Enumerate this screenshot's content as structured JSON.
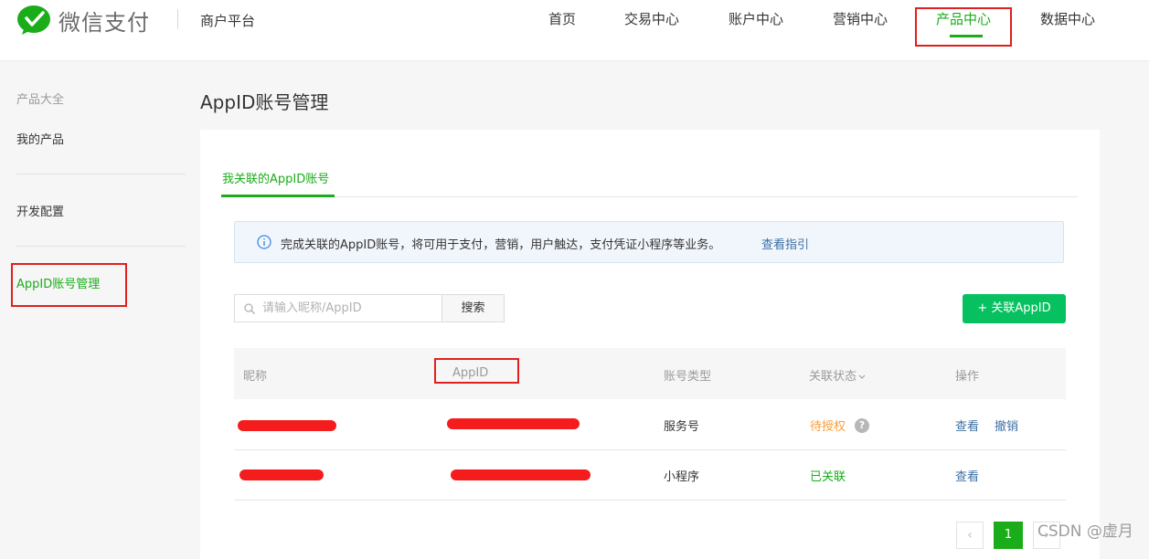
{
  "header": {
    "logo_text": "微信支付",
    "platform": "商户平台",
    "nav": [
      "首页",
      "交易中心",
      "账户中心",
      "营销中心",
      "产品中心",
      "数据中心"
    ],
    "active_nav": "产品中心"
  },
  "sidebar": {
    "group_title": "产品大全",
    "items": [
      "我的产品",
      "开发配置",
      "AppID账号管理"
    ],
    "active_item": "AppID账号管理"
  },
  "page": {
    "title": "AppID账号管理",
    "tab": "我关联的AppID账号",
    "notice": {
      "icon": "info-icon",
      "text": "完成关联的AppID账号，将可用于支付，营销，用户触达，支付凭证小程序等业务。",
      "link": "查看指引"
    },
    "search": {
      "placeholder": "请输入昵称/AppID",
      "value": "",
      "button": "搜索"
    },
    "add_button": "+ 关联AppID"
  },
  "table": {
    "headers": [
      "昵称",
      "AppID",
      "账号类型",
      "关联状态",
      "操作"
    ],
    "status_sort_icon": "chevron-down-icon",
    "rows": [
      {
        "nickname": "[redacted]",
        "appid": "[redacted]",
        "type": "服务号",
        "status": "待授权",
        "help_icon": "?",
        "actions": [
          "查看",
          "撤销"
        ]
      },
      {
        "nickname": "[redacted]",
        "appid": "[redacted]",
        "type": "小程序",
        "status": "已关联",
        "actions": [
          "查看"
        ]
      }
    ]
  },
  "pagination": {
    "prev": "‹",
    "current": "1",
    "next": "›"
  },
  "watermark": "CSDN @虚月",
  "colors": {
    "accent": "#1aad19",
    "button_green": "#07c160",
    "link": "#3d6fa3",
    "pending": "#fa9d3b",
    "highlight": "#e02020",
    "redaction": "#f41c1c"
  }
}
